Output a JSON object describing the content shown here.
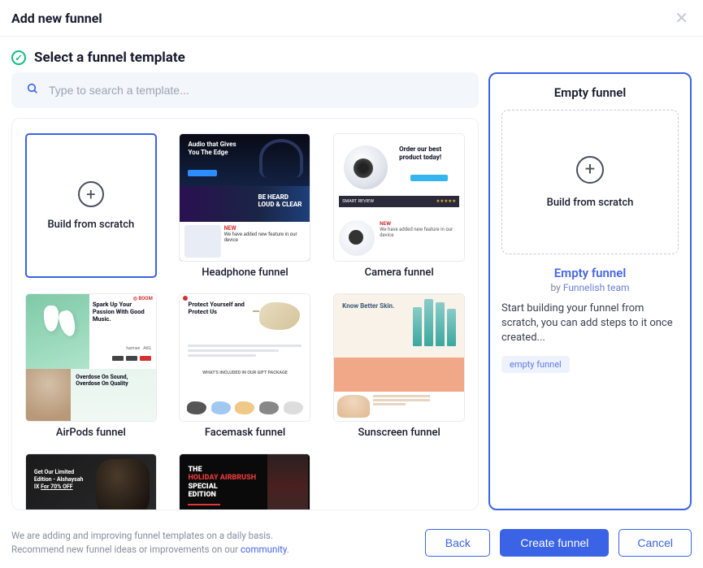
{
  "header": {
    "title": "Add new funnel"
  },
  "step": {
    "title": "Select a funnel template"
  },
  "search": {
    "placeholder": "Type to search a template..."
  },
  "templates": [
    {
      "id": "scratch",
      "label": "Build from scratch",
      "selected": true
    },
    {
      "id": "headphone",
      "label": "Headphone funnel",
      "art": {
        "line1": "Audio that Gives",
        "line2": "You The Edge",
        "mid": "BE HEARD\nLOUD & CLEAR",
        "bot_tag": "NEW",
        "bot_txt": "We have added new feature in our device"
      }
    },
    {
      "id": "camera",
      "label": "Camera funnel",
      "art": {
        "txt": "Order our best product today!",
        "banner1": "SMART REVIEW",
        "banner2": "★★★★★",
        "bot_tag": "NEW",
        "bot_txt": "We have added new feature in our device"
      }
    },
    {
      "id": "airpods",
      "label": "AirPods funnel",
      "art": {
        "txt": "Spark Up Your Passion With Good Music.",
        "logo": "BOOM",
        "bot": "Overdose On Sound, Overdose On Quality"
      }
    },
    {
      "id": "facemask",
      "label": "Facemask funnel",
      "art": {
        "txt": "Protect Yourself and Protect Us",
        "sub": "WHAT'S INCLUDED IN OUR GIFT PACKAGE"
      }
    },
    {
      "id": "sunscreen",
      "label": "Sunscreen funnel",
      "art": {
        "txt": "Know Better Skin."
      }
    },
    {
      "id": "darkoffer",
      "label": "",
      "art": {
        "txt": "Get Our Limited Edition - Alshaysah IX For 70% OFF"
      }
    },
    {
      "id": "airbrush",
      "label": "",
      "art": {
        "l1": "THE",
        "l2": "HOLIDAY AIRBRUSH",
        "l3": "SPECIAL",
        "l4": "EDITION"
      }
    }
  ],
  "preview": {
    "title": "Empty funnel",
    "scratch_label": "Build from scratch",
    "name": "Empty funnel",
    "by_label": "by",
    "author": "Funnelish team",
    "description": "Start building your funnel from scratch, you can add steps to it once created...",
    "tag": "empty funnel"
  },
  "footer": {
    "text_line1": "We are adding and improving funnel templates on a daily basis.",
    "text_line2_a": "Recommend new funnel ideas or improvements on our ",
    "text_line2_link": "community",
    "text_line2_b": ".",
    "back": "Back",
    "create": "Create funnel",
    "cancel": "Cancel"
  }
}
